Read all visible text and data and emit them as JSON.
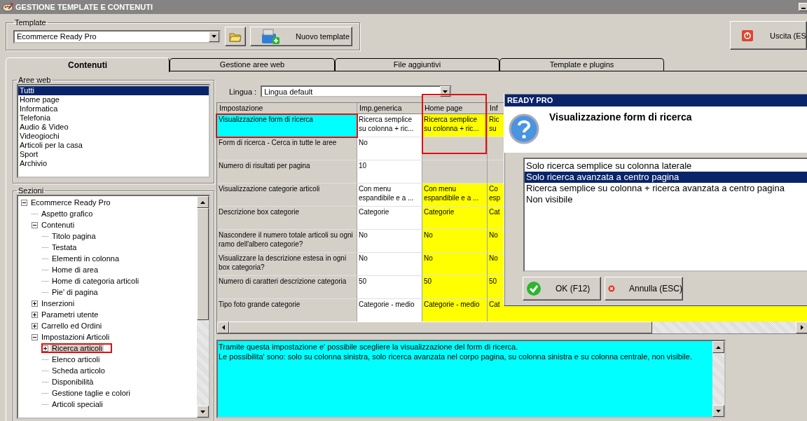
{
  "window": {
    "title": "GESTIONE TEMPLATE E CONTENUTI"
  },
  "template": {
    "label": "Template",
    "value": "Ecommerce Ready Pro",
    "new_button": "Nuovo template"
  },
  "exit_button": "Uscita (ES",
  "tabs": [
    {
      "label": "Contenuti",
      "selected": true
    },
    {
      "label": "Gestione aree web",
      "selected": false
    },
    {
      "label": "File aggiuntivi",
      "selected": false
    },
    {
      "label": "Template e plugins",
      "selected": false
    }
  ],
  "web_areas": {
    "label": "Aree web",
    "items": [
      {
        "label": "Tutti",
        "selected": true
      },
      {
        "label": "Home page",
        "selected": false
      },
      {
        "label": "Informatica",
        "selected": false
      },
      {
        "label": "Telefonia",
        "selected": false
      },
      {
        "label": "Audio & Video",
        "selected": false
      },
      {
        "label": "Videogiochi",
        "selected": false
      },
      {
        "label": "Articoli per la casa",
        "selected": false
      },
      {
        "label": "Sport",
        "selected": false
      },
      {
        "label": "Archivio",
        "selected": false
      }
    ]
  },
  "sections": {
    "label": "Sezioni",
    "tree": [
      {
        "label": "Ecommerce Ready Pro",
        "selected": false,
        "expanded": true,
        "children": [
          {
            "label": "Aspetto grafico",
            "selected": false
          },
          {
            "label": "Contenuti",
            "selected": false,
            "expanded": true,
            "children": [
              {
                "label": "Titolo pagina",
                "selected": false
              },
              {
                "label": "Testata",
                "selected": false
              },
              {
                "label": "Elementi in colonna",
                "selected": false
              },
              {
                "label": "Home di area",
                "selected": false
              },
              {
                "label": "Home di categoria articoli",
                "selected": false
              },
              {
                "label": "Pie' di pagina",
                "selected": false
              }
            ]
          },
          {
            "label": "Inserzioni",
            "selected": false,
            "expanded": false
          },
          {
            "label": "Parametri utente",
            "selected": false,
            "expanded": false
          },
          {
            "label": "Carrello ed Ordini",
            "selected": false,
            "expanded": false
          },
          {
            "label": "Impostazioni Articoli",
            "selected": false,
            "expanded": true,
            "children": [
              {
                "label": "Ricerca articoli",
                "selected": true,
                "expanded": false,
                "annotated": true
              },
              {
                "label": "Elenco articoli",
                "selected": false
              },
              {
                "label": "Scheda articolo",
                "selected": false
              },
              {
                "label": "Disponibilità",
                "selected": false
              },
              {
                "label": "Gestione taglie e colori",
                "selected": false
              },
              {
                "label": "Articoli speciali",
                "selected": false
              }
            ]
          }
        ]
      }
    ]
  },
  "language": {
    "label": "Lingua :",
    "value": "Lingua default"
  },
  "table": {
    "columns": [
      {
        "label": "Impostazione"
      },
      {
        "label": "Imp.generica"
      },
      {
        "label": "Home page",
        "annotated": true
      },
      {
        "label": "Inf"
      }
    ],
    "rows": [
      {
        "cells": [
          {
            "kind": "selected",
            "text": "Visualizzazione form di ricerca",
            "annotated": true
          },
          {
            "kind": "default",
            "text": "Ricerca semplice su colonna + ric..."
          },
          {
            "kind": "custom",
            "text": "Ricerca semplice su colonna + ric..."
          },
          {
            "kind": "custom",
            "text": "Ric\nsu"
          }
        ]
      },
      {
        "cells": [
          {
            "kind": "label",
            "text": "Form di ricerca - Cerca in tutte le aree"
          },
          {
            "kind": "default",
            "text": "No"
          },
          {
            "kind": "empty"
          },
          {
            "kind": "empty"
          }
        ]
      },
      {
        "cells": [
          {
            "kind": "label",
            "text": "Numero di risultati per pagina"
          },
          {
            "kind": "default",
            "text": "10"
          },
          {
            "kind": "empty"
          },
          {
            "kind": "empty"
          }
        ]
      },
      {
        "cells": [
          {
            "kind": "label",
            "text": "Visualizzazione categorie articoli"
          },
          {
            "kind": "default",
            "text": "Con menu espandibile e a ..."
          },
          {
            "kind": "custom",
            "text": "Con menu espandibile e a ..."
          },
          {
            "kind": "custom",
            "text": "Co\nesp"
          }
        ]
      },
      {
        "cells": [
          {
            "kind": "label",
            "text": "Descrizione box categorie"
          },
          {
            "kind": "default",
            "text": "Categorie"
          },
          {
            "kind": "custom",
            "text": "Categorie"
          },
          {
            "kind": "custom",
            "text": "Cat"
          }
        ]
      },
      {
        "cells": [
          {
            "kind": "label",
            "text": "Nascondere il numero totale articoli su ogni ramo dell'albero categorie?"
          },
          {
            "kind": "default",
            "text": "No"
          },
          {
            "kind": "custom",
            "text": "No"
          },
          {
            "kind": "custom",
            "text": "No"
          }
        ]
      },
      {
        "cells": [
          {
            "kind": "label",
            "text": "Visualizzare la descrizione estesa in ogni box categoria?"
          },
          {
            "kind": "default",
            "text": "No"
          },
          {
            "kind": "custom",
            "text": "No"
          },
          {
            "kind": "custom",
            "text": "No"
          }
        ]
      },
      {
        "cells": [
          {
            "kind": "label",
            "text": "Numero di caratteri descrizione categoria"
          },
          {
            "kind": "default",
            "text": "50"
          },
          {
            "kind": "custom",
            "text": "50"
          },
          {
            "kind": "custom",
            "text": "50"
          }
        ]
      },
      {
        "cells": [
          {
            "kind": "label",
            "text": "Tipo foto grande categorie"
          },
          {
            "kind": "default",
            "text": "Categorie - medio"
          },
          {
            "kind": "custom",
            "text": "Categorie - medio"
          },
          {
            "kind": "custom",
            "text": "Cat"
          }
        ]
      }
    ]
  },
  "description": [
    "Tramite questa impostazione e' possibile scegliere la visualizzazione del form di ricerca.",
    "Le possibilita' sono: solo su colonna sinistra, solo ricerca avanzata nel corpo pagina, su colonna sinistra e su colonna centrale, non visibile."
  ],
  "dialog": {
    "title": "READY PRO",
    "heading": "Visualizzazione form di ricerca",
    "options": [
      {
        "label": "Solo ricerca semplice su colonna laterale",
        "selected": false
      },
      {
        "label": "Solo ricerca avanzata a centro pagina",
        "selected": true
      },
      {
        "label": "Ricerca semplice su colonna + ricerca avanzata a centro pagina",
        "selected": false
      },
      {
        "label": "Non visibile",
        "selected": false
      }
    ],
    "buttons": [
      {
        "kind": "ok",
        "label": "OK (F12)"
      },
      {
        "kind": "cancel",
        "label": "Annulla (ESC)"
      }
    ]
  }
}
